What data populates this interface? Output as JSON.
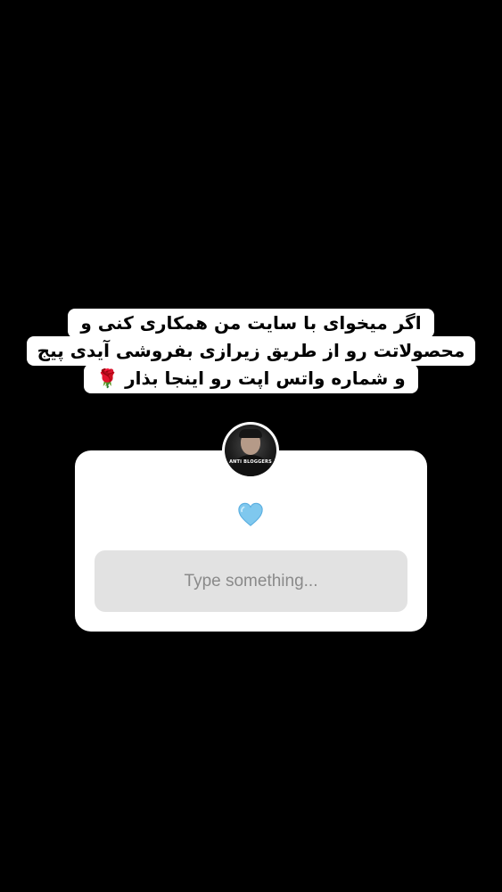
{
  "caption": {
    "line1": "اگر میخوای با سایت من همکاری کنی و",
    "line2": "محصولاتت رو از طریق زیرازی بفروشی آیدی پیج",
    "line3": "و شماره واتس اپت رو اینجا بذار",
    "line3_emoji": "🌹"
  },
  "question_sticker": {
    "avatar_caption": "ANTI BLOGGERS",
    "emoji_name": "light-blue-heart-icon",
    "answer_placeholder": "Type something..."
  },
  "colors": {
    "background": "#000000",
    "sticker_bg": "#ffffff",
    "field_bg": "#e2e2e2",
    "heart": "#7fc8ee"
  }
}
